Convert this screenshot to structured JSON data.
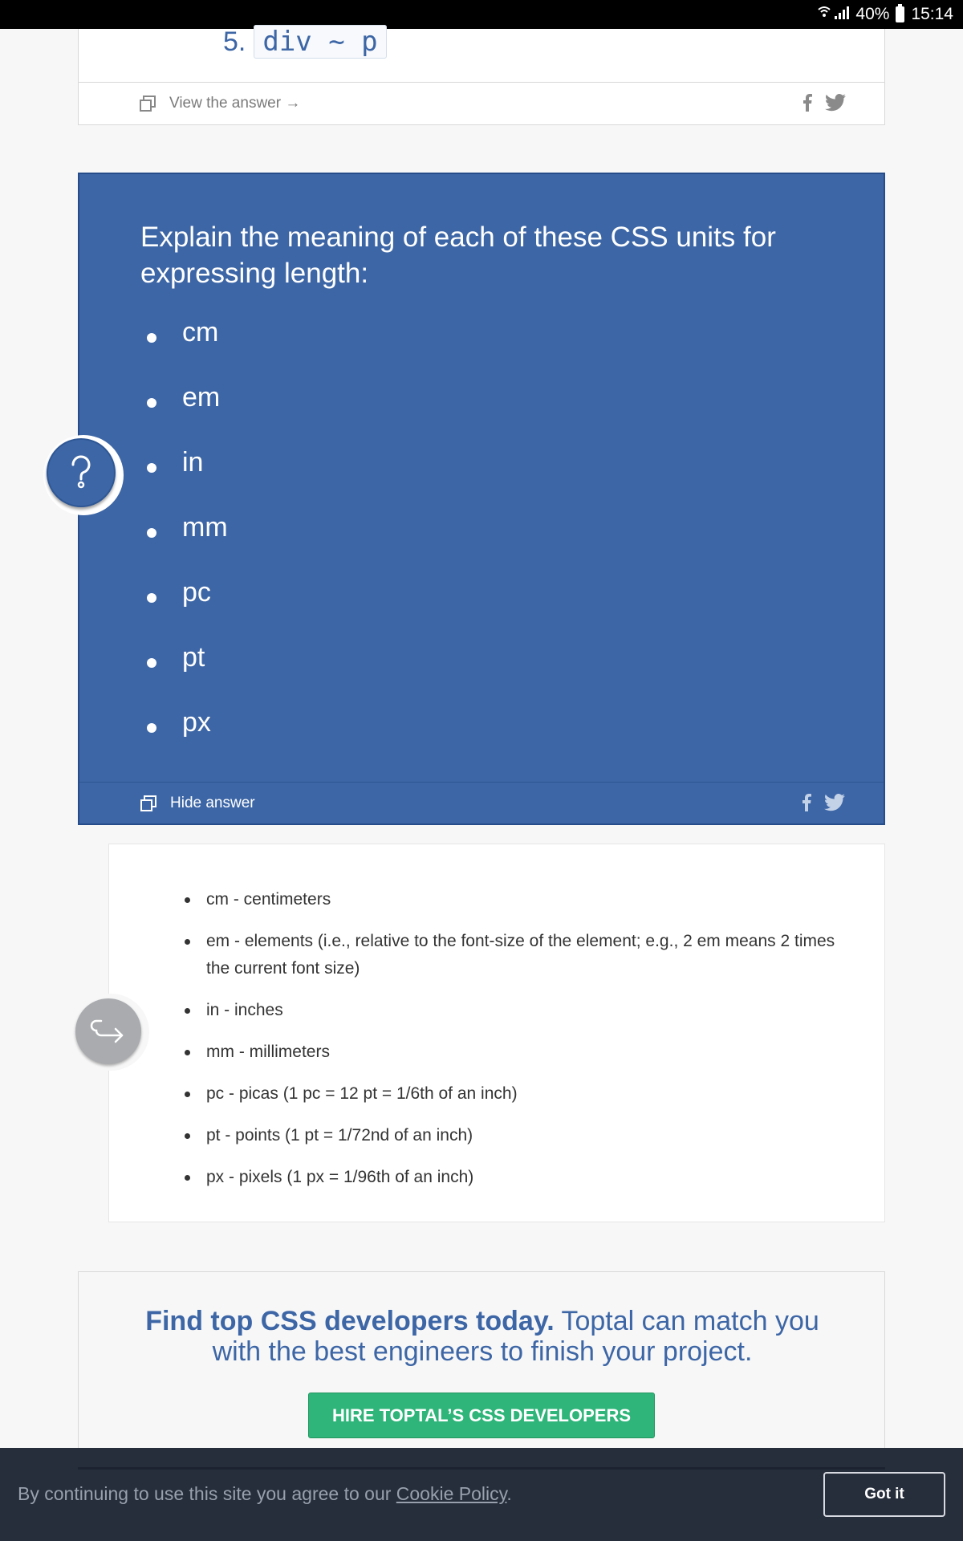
{
  "status_bar": {
    "signal": "••❘❙",
    "battery": "40%",
    "time": "15:14"
  },
  "prev_question": {
    "number": "5.",
    "code": "div ~ p",
    "view_answer_label": "View the answer →"
  },
  "question": {
    "title": "Explain the meaning of each of these CSS units for expressing length:",
    "units": [
      "cm",
      "em",
      "in",
      "mm",
      "pc",
      "pt",
      "px"
    ],
    "hide_answer_label": "Hide answer"
  },
  "answer": {
    "items": [
      "cm - centimeters",
      "em - elements (i.e., relative to the font-size of the element; e.g., 2 em means 2 times the current font size)",
      "in - inches",
      "mm - millimeters",
      "pc - picas (1 pc = 12 pt = 1/6th of an inch)",
      "pt - points (1 pt = 1/72nd of an inch)",
      "px - pixels (1 px = 1/96th of an inch)"
    ]
  },
  "promo": {
    "headline_bold": "Find top CSS developers today.",
    "headline_rest": " Toptal can match you with the best engineers to finish your project.",
    "button_label": "HIRE TOPTAL’S CSS DEVELOPERS"
  },
  "cookie": {
    "text": "By continuing to use this site you agree to our ",
    "link_label": "Cookie Policy",
    "suffix": ".",
    "button_label": "Got it"
  },
  "colors": {
    "brand_blue": "#3d66a6",
    "hire_green": "#2fb57a",
    "cookie_bg": "#262d3b"
  }
}
